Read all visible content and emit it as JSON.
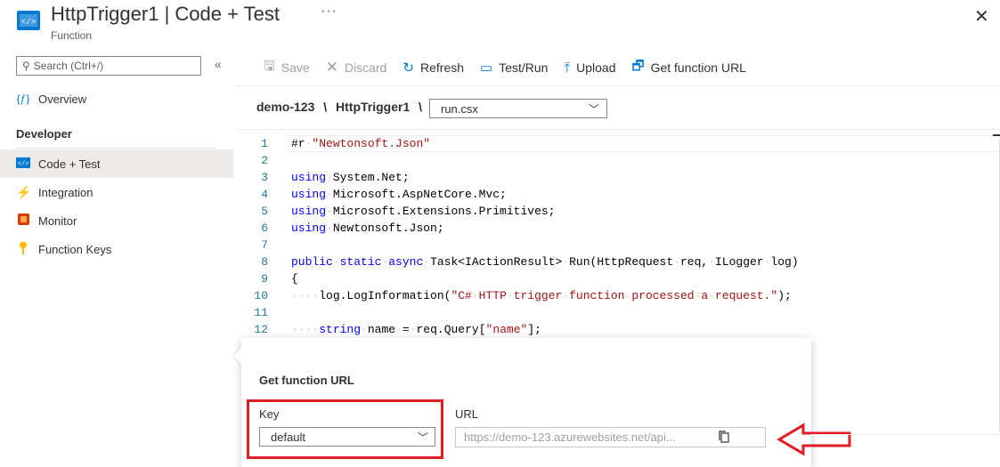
{
  "header": {
    "title": "HttpTrigger1 | Code + Test",
    "subtitle": "Function",
    "more": "···",
    "close": "✕"
  },
  "sidebar": {
    "search_placeholder": "Search (Ctrl+/)",
    "collapse": "«",
    "overview": "Overview",
    "section": "Developer",
    "items": [
      {
        "label": "Code + Test",
        "icon": "code-icon"
      },
      {
        "label": "Integration",
        "icon": "lightning-icon"
      },
      {
        "label": "Monitor",
        "icon": "monitor-icon"
      },
      {
        "label": "Function Keys",
        "icon": "key-icon"
      }
    ]
  },
  "toolbar": {
    "save": "Save",
    "discard": "Discard",
    "refresh": "Refresh",
    "test_run": "Test/Run",
    "upload": "Upload",
    "get_url": "Get function URL"
  },
  "breadcrumb": {
    "app": "demo-123",
    "sep": "\\",
    "function": "HttpTrigger1",
    "file": "run.csx"
  },
  "editor": {
    "line_numbers": [
      "1",
      "2",
      "3",
      "4",
      "5",
      "6",
      "7",
      "8",
      "9",
      "10",
      "11",
      "12"
    ]
  },
  "callout": {
    "title": "Get function URL",
    "key_label": "Key",
    "key_value": "default",
    "url_label": "URL",
    "url_value": "https://demo-123.azurewebsites.net/api..."
  },
  "colors": {
    "accent": "#0078d4",
    "highlight": "#e31b23"
  }
}
